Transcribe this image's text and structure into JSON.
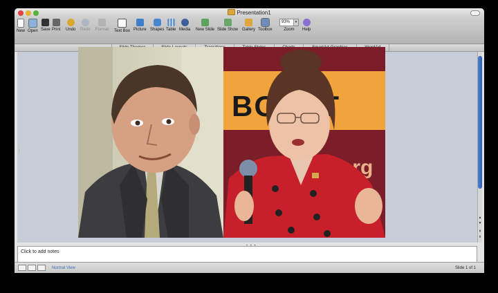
{
  "window": {
    "title": "Presentation1",
    "zoom_value": "93%"
  },
  "toolbar": [
    {
      "label": "New",
      "icon": "new-doc-icon",
      "enabled": true
    },
    {
      "label": "Open",
      "icon": "open-icon",
      "enabled": true
    },
    {
      "label": "Save",
      "icon": "save-icon",
      "enabled": true
    },
    {
      "label": "Print",
      "icon": "print-icon",
      "enabled": true
    },
    {
      "label": "Undo",
      "icon": "undo-icon",
      "enabled": true
    },
    {
      "label": "Redo",
      "icon": "redo-icon",
      "enabled": false
    },
    {
      "label": "Format",
      "icon": "format-brush-icon",
      "enabled": false
    },
    {
      "label": "Text Box",
      "icon": "text-box-icon",
      "enabled": true
    },
    {
      "label": "Picture",
      "icon": "picture-icon",
      "enabled": true
    },
    {
      "label": "Shapes",
      "icon": "shapes-icon",
      "enabled": true
    },
    {
      "label": "Table",
      "icon": "table-icon",
      "enabled": true
    },
    {
      "label": "Media",
      "icon": "media-icon",
      "enabled": true
    },
    {
      "label": "New Slide",
      "icon": "new-slide-icon",
      "enabled": true
    },
    {
      "label": "Slide Show",
      "icon": "slide-show-icon",
      "enabled": true
    },
    {
      "label": "Gallery",
      "icon": "gallery-icon",
      "enabled": true
    },
    {
      "label": "Toolbox",
      "icon": "toolbox-icon",
      "enabled": true,
      "active": true
    },
    {
      "label": "Zoom",
      "icon": "zoom-icon",
      "enabled": true
    },
    {
      "label": "Help",
      "icon": "help-icon",
      "enabled": true
    }
  ],
  "ribbon_tabs": [
    "Slide Themes",
    "Slide Layouts",
    "Transitions",
    "Table Styles",
    "Charts",
    "SmartArt Graphics",
    "WordArt"
  ],
  "slide": {
    "banner_text": "BOLOT",
    "banner_org": "org"
  },
  "notes": {
    "placeholder": "Click to add notes"
  },
  "status": {
    "view_name": "Normal View",
    "slide_counter": "Slide 1 of 1"
  },
  "colors": {
    "accent": "#3a6fb5",
    "banner": "#f2a43c",
    "jacket": "#c8202a"
  }
}
